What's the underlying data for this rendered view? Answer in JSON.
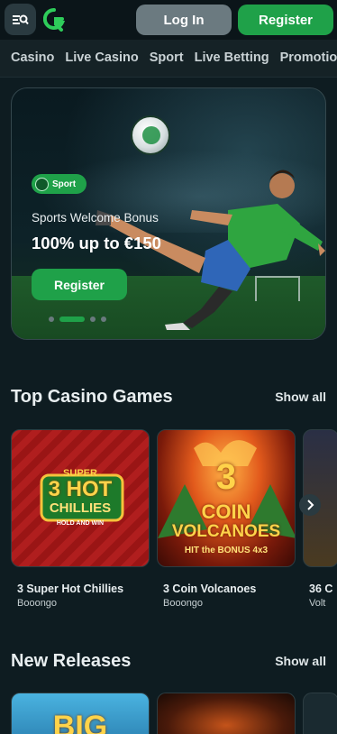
{
  "header": {
    "menu_icon": "menu-search-icon",
    "logo_icon": "brand-logo-icon",
    "login_label": "Log In",
    "register_label": "Register",
    "colors": {
      "accent": "#1fa149",
      "login_bg": "#6b7a80",
      "background": "#0e1c21"
    }
  },
  "nav": {
    "items": [
      "Casino",
      "Live Casino",
      "Sport",
      "Live Betting",
      "Promotio"
    ]
  },
  "hero": {
    "badge": "Sport",
    "subtitle": "Sports Welcome Bonus",
    "title": "100% up to €150",
    "cta": "Register",
    "slide_count": 4,
    "active_slide": 2
  },
  "top_casino": {
    "title": "Top Casino Games",
    "show_all": "Show all",
    "games": [
      {
        "name": "3 Super Hot Chillies",
        "provider": "Booongo",
        "art_text": [
          "SUPER",
          "3",
          "HOT",
          "CHILLIES",
          "HOLD AND WIN"
        ]
      },
      {
        "name": "3 Coin Volcanoes",
        "provider": "Booongo",
        "art_text": [
          "3",
          "COIN",
          "VOLCANOES",
          "HIT the BONUS",
          "4x3"
        ]
      },
      {
        "name": "36 C",
        "provider": "Volt"
      }
    ]
  },
  "new_releases": {
    "title": "New Releases",
    "show_all": "Show all",
    "art_text": [
      "BIG"
    ]
  }
}
